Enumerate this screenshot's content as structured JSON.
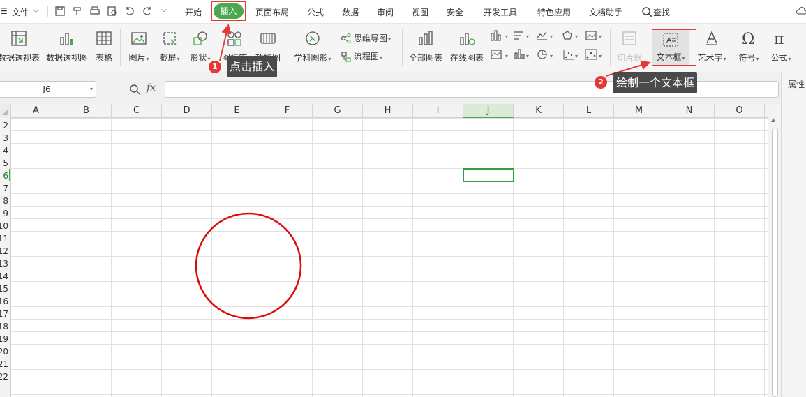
{
  "menubar": {
    "file_label": "文件",
    "tabs": [
      "开始",
      "插入",
      "页面布局",
      "公式",
      "数据",
      "审阅",
      "视图",
      "安全",
      "开发工具",
      "特色应用",
      "文档助手"
    ],
    "search_label": "查找"
  },
  "ribbon": {
    "pivot_table": "数据透视表",
    "pivot_chart": "数据透视图",
    "table": "表格",
    "picture": "图片",
    "screenshot": "截屏",
    "shapes": "形状",
    "icon_lib": "图标库",
    "function_chart": "功能图",
    "science_graph": "学科图形",
    "mind_map": "思维导图",
    "flowchart": "流程图",
    "all_charts": "全部图表",
    "online_charts": "在线图表",
    "slicer": "切片器",
    "text_box": "文本框",
    "word_art": "艺术字",
    "symbol": "符号",
    "formula": "公式"
  },
  "formula_bar": {
    "name_box": "J6",
    "fx": "fx",
    "value": ""
  },
  "side_pane": {
    "label": "属性"
  },
  "grid": {
    "columns": [
      "A",
      "B",
      "C",
      "D",
      "E",
      "F",
      "G",
      "H",
      "I",
      "J",
      "K",
      "L",
      "M",
      "N",
      "O"
    ],
    "selected_column": "J",
    "rows": [
      "2",
      "3",
      "4",
      "5",
      "6",
      "7",
      "8",
      "9",
      "10",
      "11",
      "12",
      "13",
      "14",
      "15",
      "16",
      "17",
      "18",
      "19",
      "20",
      "21",
      "22"
    ],
    "selected_row": "6",
    "active_cell": "J6"
  },
  "annotations": {
    "step1_number": "1",
    "step1_text": "点击插入",
    "step2_number": "2",
    "step2_text": "绘制一个文本框",
    "color": "#e53935"
  }
}
